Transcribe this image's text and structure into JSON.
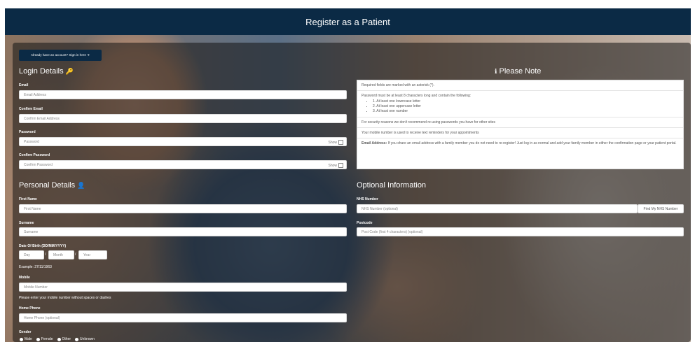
{
  "header": {
    "title": "Register as a Patient"
  },
  "signin_label": "Already have an account? Sign in here ➔",
  "login": {
    "heading": "Login Details",
    "email": {
      "label": "Email",
      "placeholder": "Email Address"
    },
    "confirm_email": {
      "label": "Confirm Email",
      "placeholder": "Confirm Email Address"
    },
    "password": {
      "label": "Password",
      "placeholder": "Password",
      "show": "Show"
    },
    "confirm_password": {
      "label": "Confirm Password",
      "placeholder": "Confirm Password",
      "show": "Show"
    }
  },
  "personal": {
    "heading": "Personal Details",
    "first_name": {
      "label": "First Name",
      "placeholder": "First Name"
    },
    "surname": {
      "label": "Surname",
      "placeholder": "Surname"
    },
    "dob": {
      "label": "Date Of Birth (DD/MM/YYYY)",
      "day": "Day",
      "month": "Month",
      "year": "Year",
      "example": "Example: 27/11/1963"
    },
    "mobile": {
      "label": "Mobile",
      "placeholder": "Mobile Number",
      "help": "Please enter your mobile number without spaces or dashes"
    },
    "home_phone": {
      "label": "Home Phone",
      "placeholder": "Home Phone (optional)"
    },
    "gender": {
      "label": "Gender",
      "options": [
        "Male",
        "Female",
        "Other",
        "Unknown"
      ]
    }
  },
  "note": {
    "heading": "Please Note",
    "required": "Required fields are marked with an asterisk (*).",
    "pw_intro": "Password must be at least 8 characters long and contain the following:",
    "pw_rules": [
      "1. At least one lowercase letter",
      "2. At least one uppercase letter",
      "3. At least one number"
    ],
    "security": "For security reasons we don't recommend re-using passwords you have for other sites",
    "mobile_note": "Your mobile number is used to receive text reminders for your appointments",
    "email_label": "Email Address:",
    "email_note": " If you share an email address with a family member you do not need to re-register! Just log in as normal and add your family member in either the confirmation page or your patient portal."
  },
  "optional": {
    "heading": "Optional Information",
    "nhs": {
      "label": "NHS Number",
      "placeholder": "NHS Number  (optional)",
      "button": "Find My NHS Number"
    },
    "postcode": {
      "label": "Postcode",
      "placeholder": "Post Code (first 4 characters)  (optional)"
    }
  }
}
